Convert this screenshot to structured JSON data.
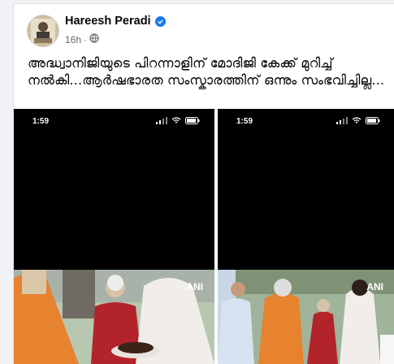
{
  "post": {
    "author_name": "Hareesh Peradi",
    "timestamp": "16h",
    "separator": "·",
    "verified_icon": "verified-badge-icon",
    "privacy_icon": "globe-icon",
    "text": "അദ്ധ്വാനിജിയുടെ പിറന്നാളിന് മോദിജി കേക്ക് മുറിച്ച് നൽകി...ആർഷഭാരത സംസ്കാരത്തിന് ഒന്നും സംഭവിച്ചില്ല..."
  },
  "media": {
    "left": {
      "clock": "1:59",
      "watermark": "ANI"
    },
    "right": {
      "clock": "1:59",
      "watermark": "ANI"
    }
  },
  "colors": {
    "accent": "#1877f2",
    "text": "#050505",
    "muted": "#65676b"
  }
}
